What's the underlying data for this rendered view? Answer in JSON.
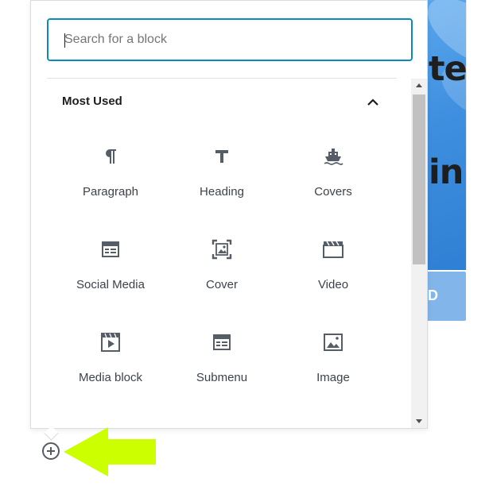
{
  "search": {
    "placeholder": "Search for a block",
    "value": ""
  },
  "panel": {
    "title": "Most Used",
    "blocks": [
      {
        "label": "Paragraph",
        "icon": "paragraph-icon"
      },
      {
        "label": "Heading",
        "icon": "heading-icon"
      },
      {
        "label": "Covers",
        "icon": "ship-icon"
      },
      {
        "label": "Social Media",
        "icon": "table-layout-icon"
      },
      {
        "label": "Cover",
        "icon": "cover-image-icon"
      },
      {
        "label": "Video",
        "icon": "video-icon"
      },
      {
        "label": "Media block",
        "icon": "media-play-icon"
      },
      {
        "label": "Submenu",
        "icon": "table-layout-icon"
      },
      {
        "label": "Image",
        "icon": "image-icon"
      }
    ]
  },
  "background": {
    "hero_text_line1": "te",
    "hero_text_line2": "in",
    "button_text": "D"
  },
  "colors": {
    "accent": "#0b8bba",
    "highlight_arrow": "#ccff00",
    "hero_blue": "#3f8fe0",
    "icon_gray": "#555d66"
  }
}
